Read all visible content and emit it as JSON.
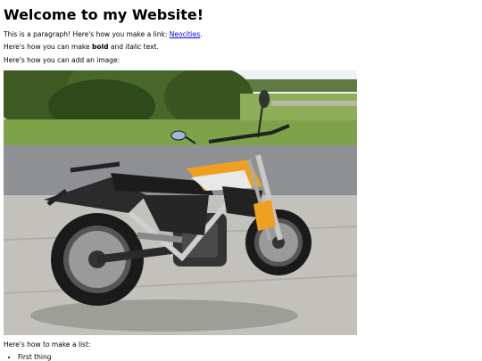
{
  "heading": "Welcome to my Website!",
  "intro": {
    "prefix": "This is a paragraph! Here's how you make a link: ",
    "link_text": "Neocities",
    "suffix": "."
  },
  "format": {
    "prefix": "Here's how you can make ",
    "bold": "bold",
    "middle": " and ",
    "italic": "italic",
    "suffix": " text."
  },
  "image_caption": "Here's how you can add an image:",
  "list_intro": "Here's how to make a list:",
  "list_items": [
    "First thing"
  ],
  "colors": {
    "link": "#0000ee",
    "bike_orange": "#f0a020"
  }
}
